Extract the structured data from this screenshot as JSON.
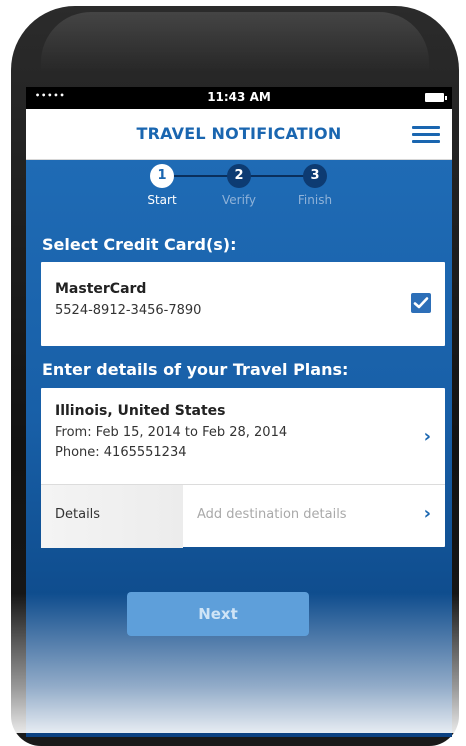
{
  "status_bar": {
    "signal": "•••••",
    "time": "11:43 AM"
  },
  "header": {
    "title": "TRAVEL NOTIFICATION",
    "menu_icon": "hamburger-menu-icon"
  },
  "stepper": {
    "steps": [
      {
        "number": "1",
        "label": "Start",
        "state": "active"
      },
      {
        "number": "2",
        "label": "Verify",
        "state": "inactive"
      },
      {
        "number": "3",
        "label": "Finish",
        "state": "inactive"
      }
    ]
  },
  "credit_cards": {
    "section_title": "Select Credit Card(s):",
    "card": {
      "name": "MasterCard",
      "number": "5524-8912-3456-7890",
      "checked": true
    }
  },
  "travel_plans": {
    "section_title": "Enter details of your Travel Plans:",
    "destination": "Illinois, United States",
    "dates": "From: Feb 15, 2014 to Feb 28, 2014",
    "phone": "Phone: 4165551234",
    "chevron": "›",
    "details_label": "Details",
    "details_placeholder": "Add destination details"
  },
  "actions": {
    "next_label": "Next"
  },
  "colors": {
    "primary_blue": "#1a66b0",
    "background_blue": "#185fa7",
    "button_blue": "#5e9fda"
  }
}
